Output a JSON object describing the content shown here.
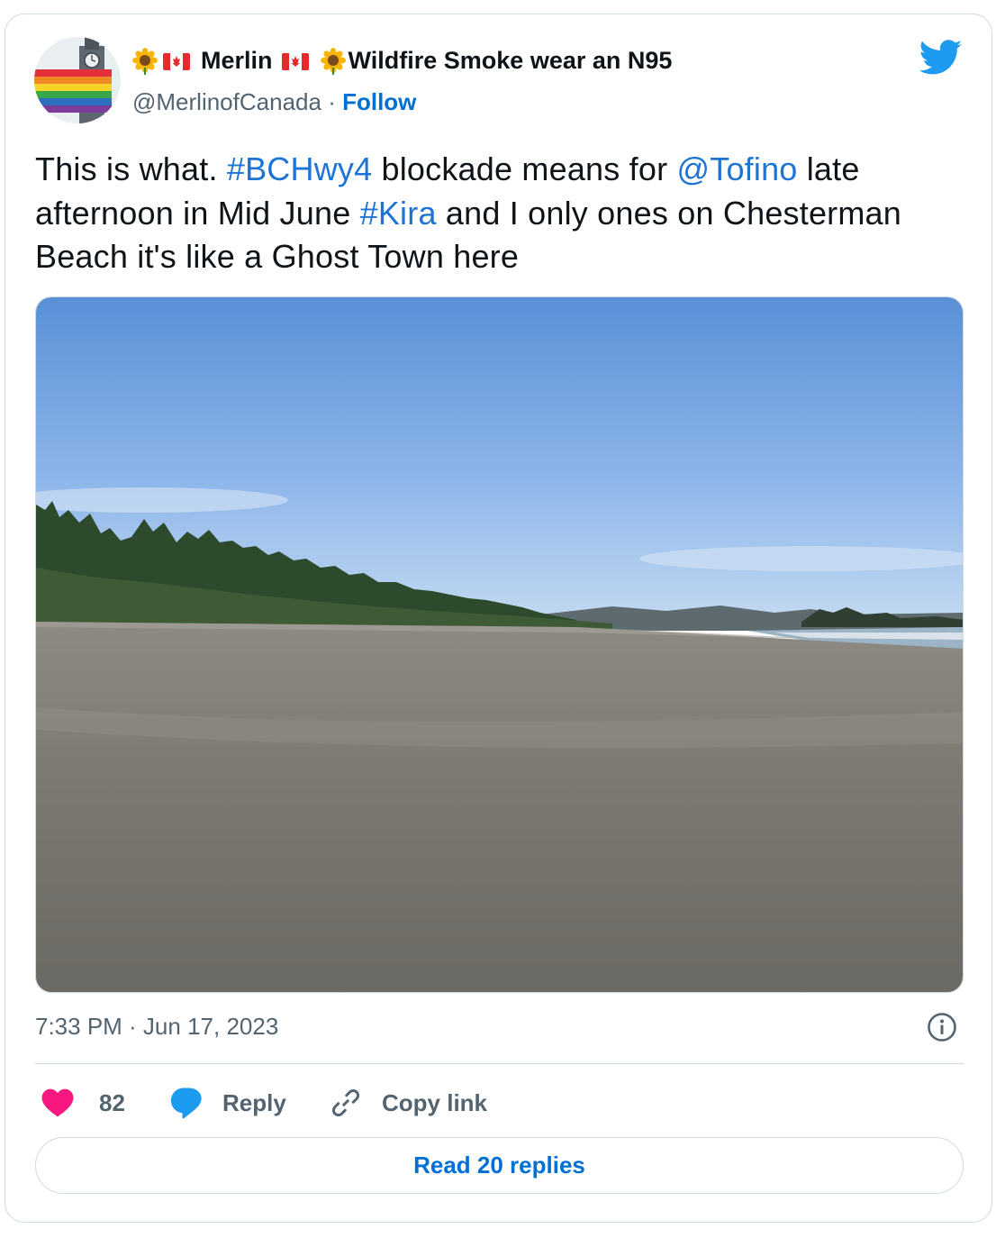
{
  "author": {
    "name_prefix": "Merlin",
    "name_suffix": "Wildfire Smoke wear an N95",
    "handle": "@MerlinofCanada",
    "separator": "·",
    "follow_label": "Follow"
  },
  "tweet": {
    "segments": [
      {
        "text": "This is what. ",
        "link": false
      },
      {
        "text": "#BCHwy4",
        "link": true
      },
      {
        "text": " blockade means for ",
        "link": false
      },
      {
        "text": "@Tofino",
        "link": true
      },
      {
        "text": " late afternoon in Mid June ",
        "link": false
      },
      {
        "text": "#Kira",
        "link": true
      },
      {
        "text": " and I only ones on Chesterman Beach it's like a Ghost Town here",
        "link": false
      }
    ],
    "timestamp": "7:33 PM · Jun 17, 2023"
  },
  "actions": {
    "likes": "82",
    "reply_label": "Reply",
    "copy_label": "Copy link",
    "read_replies_label": "Read 20 replies"
  },
  "icons": {
    "emoji_sunflower": "sunflower-icon",
    "emoji_flag": "canada-flag-icon",
    "twitter_logo": "twitter-bird-icon",
    "info": "info-icon",
    "like": "heart-icon",
    "reply": "reply-bubble-icon",
    "copy": "link-icon"
  },
  "colors": {
    "link_blue": "#1d74d4",
    "follow_blue": "#006fd6",
    "like_red": "#f91880",
    "reply_blue": "#1d9bf0",
    "twitter_blue": "#1d9bf0",
    "muted_text": "#536471",
    "border": "#cfd9de"
  }
}
